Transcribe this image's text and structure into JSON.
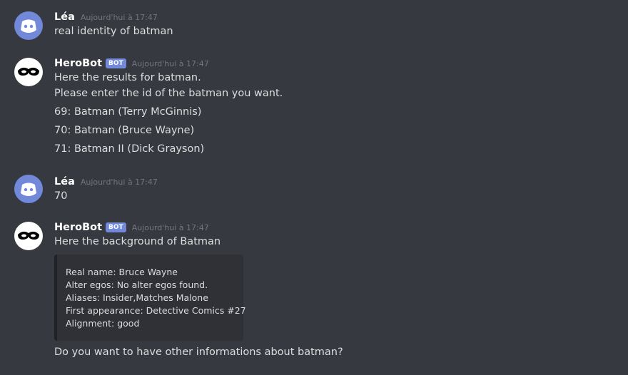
{
  "messages": [
    {
      "username": "Léa",
      "timestamp": "Aujourd'hui à 17:47",
      "lines": [
        "real identity of batman"
      ]
    },
    {
      "username": "HeroBot",
      "badge": "BOT",
      "timestamp": "Aujourd'hui à 17:47",
      "lines": [
        "Here the results for batman.",
        "Please enter the id of the batman you want.",
        "69: Batman (Terry McGinnis)",
        "70: Batman (Bruce Wayne)",
        "71: Batman II (Dick Grayson)"
      ]
    },
    {
      "username": "Léa",
      "timestamp": "Aujourd'hui à 17:47",
      "lines": [
        "70"
      ]
    },
    {
      "username": "HeroBot",
      "badge": "BOT",
      "timestamp": "Aujourd'hui à 17:47",
      "lines": [
        "Here the background of Batman"
      ],
      "embed": [
        "Real name: Bruce Wayne",
        "Alter egos: No alter egos found.",
        "Aliases: Insider,Matches Malone",
        "First appearance: Detective Comics #27",
        "Alignment: good"
      ],
      "after": "Do you want to have other informations about batman?"
    }
  ],
  "icons": {
    "discord_avatar": "discord-logo",
    "herobot_avatar": "mask",
    "discord_avatar_color": "#7289da",
    "badge_color": "#7289da"
  }
}
